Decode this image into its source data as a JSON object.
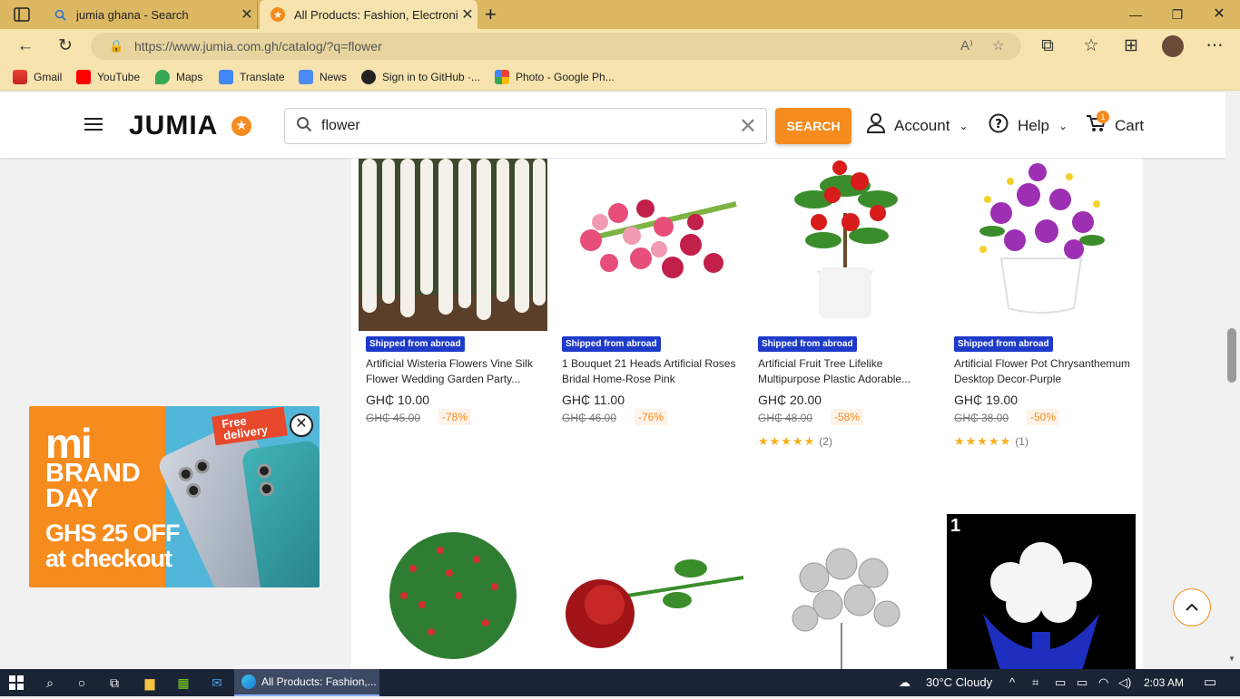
{
  "browser": {
    "tabs": [
      {
        "title": "jumia ghana - Search",
        "icon": "search-icon"
      },
      {
        "title": "All Products: Fashion, Electronics",
        "icon": "jumia-star-icon"
      }
    ],
    "url": "https://www.jumia.com.gh/catalog/?q=flower",
    "bookmarks": [
      "Gmail",
      "YouTube",
      "Maps",
      "Translate",
      "News",
      "Sign in to GitHub ·...",
      "Photo - Google Ph..."
    ]
  },
  "header": {
    "logo": "JUMIA",
    "search_value": "flower",
    "search_button": "SEARCH",
    "account": "Account",
    "help": "Help",
    "cart": "Cart",
    "cart_count": "1"
  },
  "products": [
    {
      "badge": "Shipped from abroad",
      "name": "Artificial Wisteria Flowers Vine Silk Flower Wedding Garden Party...",
      "price": "GH₵ 10.00",
      "old": "GH₵ 45.00",
      "discount": "-78%",
      "rating": "",
      "count": ""
    },
    {
      "badge": "Shipped from abroad",
      "name": "1 Bouquet 21 Heads Artificial Roses Bridal Home-Rose Pink",
      "price": "GH₵ 11.00",
      "old": "GH₵ 46.00",
      "discount": "-76%",
      "rating": "",
      "count": ""
    },
    {
      "badge": "Shipped from abroad",
      "name": "Artificial Fruit Tree Lifelike Multipurpose Plastic Adorable...",
      "price": "GH₵ 20.00",
      "old": "GH₵ 48.00",
      "discount": "-58%",
      "rating": "★★★★★",
      "count": "(2)"
    },
    {
      "badge": "Shipped from abroad",
      "name": "Artificial Flower Pot Chrysanthemum Desktop Decor-Purple",
      "price": "GH₵ 19.00",
      "old": "GH₵ 38.00",
      "discount": "-50%",
      "rating": "★★★★★",
      "count": "(1)"
    }
  ],
  "ad": {
    "logo": "mi",
    "brand": "BRAND DAY",
    "offer_line1": "GHS 25 OFF",
    "offer_line2": "at checkout",
    "sticker": "Free delivery"
  },
  "row2_label": "1",
  "taskbar": {
    "app": "All Products: Fashion,...",
    "weather": "30°C  Cloudy",
    "time": "2:03 AM"
  }
}
